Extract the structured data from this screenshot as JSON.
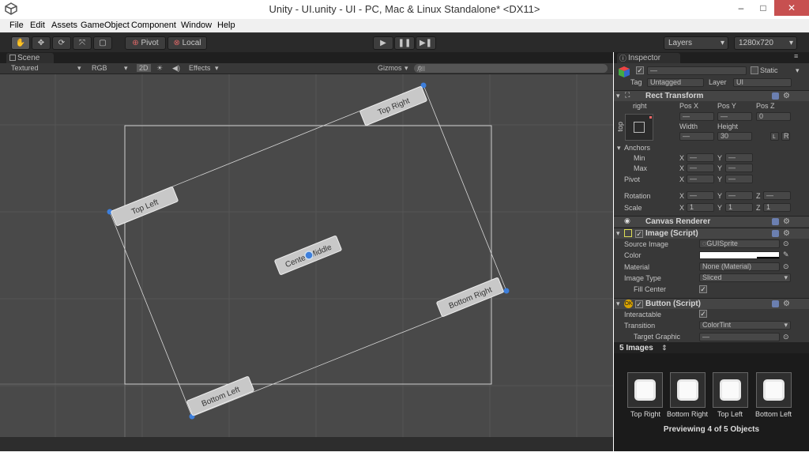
{
  "window": {
    "title": "Unity - UI.unity - UI - PC, Mac & Linux Standalone* <DX11>",
    "minimize": "–",
    "maximize": "□",
    "close": "✕"
  },
  "menu": [
    "File",
    "Edit",
    "Assets",
    "GameObject",
    "Component",
    "Window",
    "Help"
  ],
  "toolbar": {
    "pivot": "Pivot",
    "local": "Local",
    "layers": "Layers",
    "resolution": "1280x720"
  },
  "scene": {
    "tab": "Scene",
    "shading": "Textured",
    "render_mode": "RGB",
    "mode_2d": "2D",
    "effects": "Effects",
    "gizmos": "Gizmos",
    "search_placeholder": "All",
    "buttons": {
      "top_right": "Top Right",
      "top_left": "Top Left",
      "center": "Center Middle",
      "bottom_right": "Bottom Right",
      "bottom_left": "Bottom Left"
    }
  },
  "inspector": {
    "tab": "Inspector",
    "name_value": "—",
    "static": "Static",
    "tag_label": "Tag",
    "tag_value": "Untagged",
    "layer_label": "Layer",
    "layer_value": "UI",
    "rect_transform": {
      "title": "Rect Transform",
      "anchor_h": "right",
      "anchor_v": "top",
      "pos_x": "Pos X",
      "pos_y": "Pos Y",
      "pos_z": "Pos Z",
      "pos_x_val": "—",
      "pos_y_val": "—",
      "pos_z_val": "0",
      "width": "Width",
      "height": "Height",
      "width_val": "—",
      "height_val": "30",
      "blueprint_btn": "",
      "raw_btn": "R",
      "anchors": "Anchors",
      "min": "Min",
      "max": "Max",
      "pivot": "Pivot",
      "rotation": "Rotation",
      "scale": "Scale",
      "x": "X",
      "y": "Y",
      "z": "Z",
      "dash": "—",
      "scale_x": "1",
      "scale_y": "1",
      "scale_z": "1"
    },
    "canvas_renderer": "Canvas Renderer",
    "image": {
      "title": "Image (Script)",
      "source_image": "Source Image",
      "source_value": "GUISprite",
      "color": "Color",
      "material": "Material",
      "material_value": "None (Material)",
      "image_type": "Image Type",
      "image_type_value": "Sliced",
      "fill_center": "Fill Center"
    },
    "button": {
      "title": "Button (Script)",
      "interactable": "Interactable",
      "transition": "Transition",
      "transition_value": "ColorTint",
      "target_graphic": "Target Graphic",
      "target_value": "—"
    },
    "preview": {
      "header": "5 Images",
      "items": [
        "Top Right",
        "Bottom Right",
        "Top Left",
        "Bottom Left"
      ],
      "footer": "Previewing 4 of 5 Objects"
    }
  },
  "colors": {
    "scene_bg": "#494949",
    "accent_blue": "#3d7fdc"
  }
}
